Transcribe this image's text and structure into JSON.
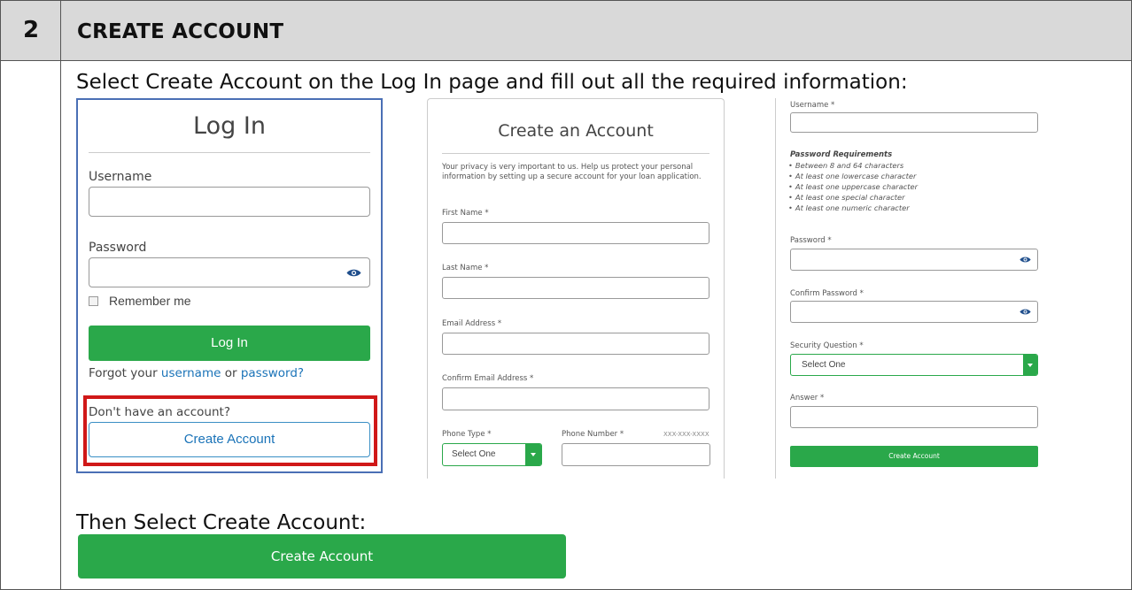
{
  "step": {
    "number": "2",
    "title": "CREATE ACCOUNT"
  },
  "instructions": {
    "line1": "Select Create Account on the Log In page and fill out all the required information:",
    "line2": "Then Select Create Account:"
  },
  "login": {
    "title": "Log In",
    "username_label": "Username",
    "password_label": "Password",
    "remember_label": "Remember me",
    "login_button": "Log In",
    "forgot_prefix": "Forgot your ",
    "forgot_username": "username",
    "forgot_or": " or ",
    "forgot_password": "password?",
    "no_account": "Don't have an account?",
    "create_button": "Create Account"
  },
  "create_form": {
    "title": "Create an Account",
    "privacy": "Your privacy is very important to us. Help us protect your personal information by setting up a secure account for your loan application.",
    "first_name": "First Name *",
    "last_name": "Last Name *",
    "email": "Email Address *",
    "confirm_email": "Confirm Email Address *",
    "phone_type": "Phone Type *",
    "phone_type_value": "Select One",
    "phone_number": "Phone Number *",
    "phone_format": "XXX-XXX-XXXX"
  },
  "right_form": {
    "username": "Username *",
    "requirements_title": "Password Requirements",
    "requirements": [
      "Between 8 and 64 characters",
      "At least one lowercase character",
      "At least one uppercase character",
      "At least one special character",
      "At least one numeric character"
    ],
    "password": "Password *",
    "confirm_password": "Confirm Password *",
    "security_question": "Security Question *",
    "security_value": "Select One",
    "answer": "Answer *",
    "create_button": "Create Account"
  },
  "final_button": "Create Account",
  "colors": {
    "green": "#2aa84a",
    "link": "#1a73b8",
    "highlight": "#d01818",
    "panel_border": "#4a6fb5",
    "eye": "#1f4e8c"
  }
}
